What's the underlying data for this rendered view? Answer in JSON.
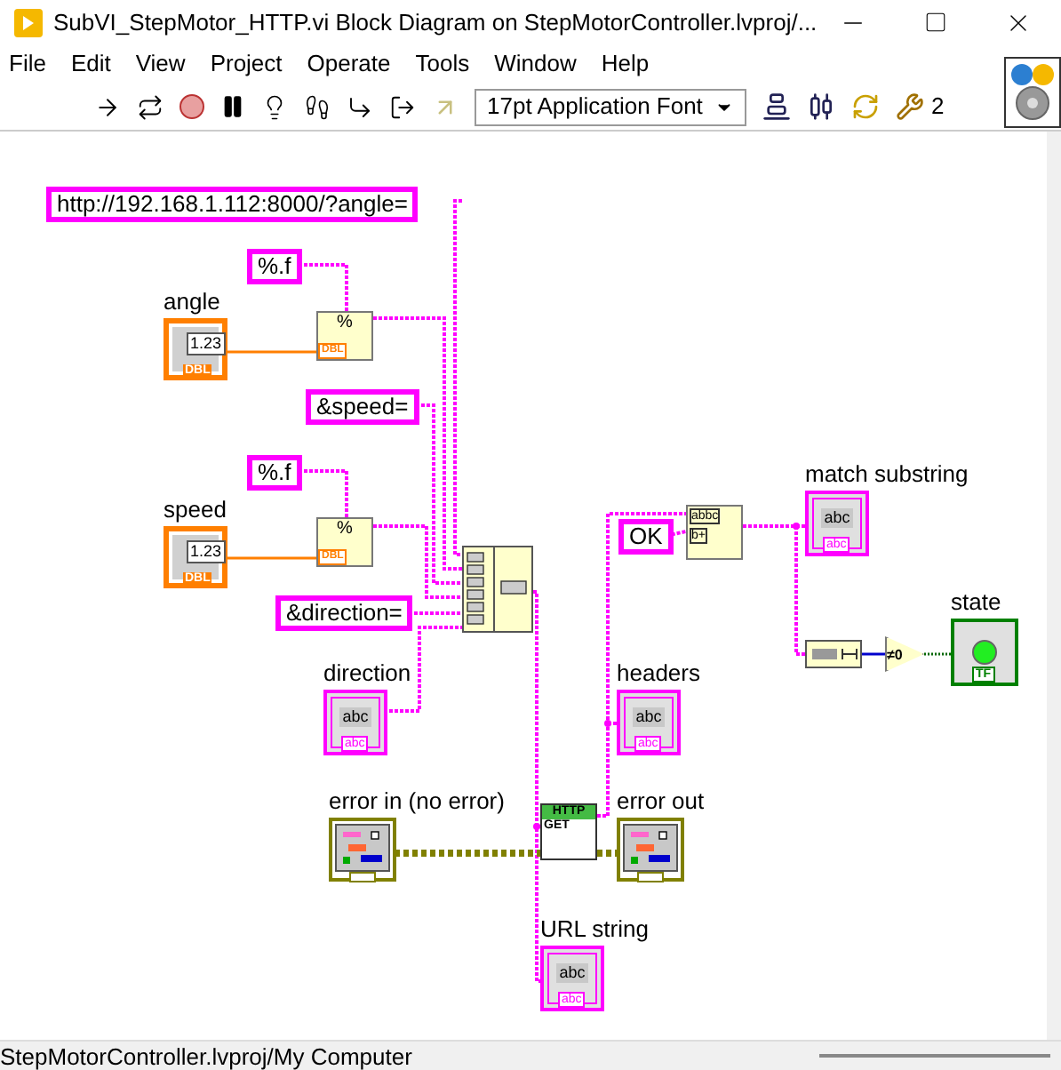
{
  "window": {
    "title": "SubVI_StepMotor_HTTP.vi Block Diagram on StepMotorController.lvproj/..."
  },
  "menu": [
    "File",
    "Edit",
    "View",
    "Project",
    "Operate",
    "Tools",
    "Window",
    "Help"
  ],
  "toolbar": {
    "font_selector": "17pt Application Font",
    "cut_text": "2"
  },
  "diagram": {
    "constants": [
      {
        "kind": "string",
        "text": "http://192.168.1.112:8000/?angle="
      },
      {
        "kind": "string",
        "text": "%.f"
      },
      {
        "kind": "string",
        "text": "&speed="
      },
      {
        "kind": "string",
        "text": "%.f"
      },
      {
        "kind": "string",
        "text": "&direction="
      },
      {
        "kind": "string",
        "text": "OK"
      }
    ],
    "controls": [
      {
        "kind": "numeric",
        "label": "angle",
        "value": "1.23",
        "type_tag": "DBL"
      },
      {
        "kind": "numeric",
        "label": "speed",
        "value": "1.23",
        "type_tag": "DBL"
      },
      {
        "kind": "string",
        "label": "direction",
        "value": "abc",
        "type_tag": "abc"
      },
      {
        "kind": "error",
        "label": "error in (no error)"
      }
    ],
    "indicators": [
      {
        "kind": "string",
        "label": "match substring",
        "value": "abc",
        "type_tag": "abc"
      },
      {
        "kind": "boolean",
        "label": "state",
        "on": true,
        "type_tag": "TF"
      },
      {
        "kind": "string",
        "label": "headers",
        "value": "abc",
        "type_tag": "abc"
      },
      {
        "kind": "error",
        "label": "error out"
      },
      {
        "kind": "string",
        "label": "URL string",
        "value": "abc",
        "type_tag": "abc"
      }
    ],
    "functions": [
      {
        "kind": "format",
        "symbol": "%",
        "type_tag": "DBL"
      },
      {
        "kind": "format",
        "symbol": "%",
        "type_tag": "DBL"
      },
      {
        "kind": "concatenate"
      },
      {
        "kind": "match_pattern",
        "texts": [
          "abbc",
          "b+"
        ]
      },
      {
        "kind": "string_length"
      },
      {
        "kind": "not_equal_zero",
        "symbol": "≠0"
      },
      {
        "kind": "http_get",
        "header": "HTTP",
        "method": "GET"
      }
    ]
  },
  "status_bar": {
    "text": "StepMotorController.lvproj/My Computer"
  }
}
